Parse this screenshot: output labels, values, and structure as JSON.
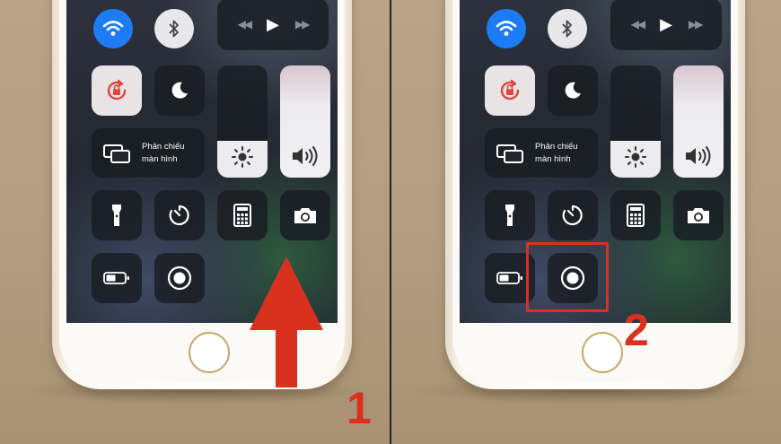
{
  "panels": [
    {
      "id": "left",
      "step_label": "1",
      "mirror_label_line1": "Phản chiếu",
      "mirror_label_line2": "màn hình"
    },
    {
      "id": "right",
      "step_label": "2",
      "mirror_label_line1": "Phản chiếu",
      "mirror_label_line2": "màn hình"
    }
  ],
  "control_center": {
    "brightness_level": 0.33,
    "volume_level": 1.0,
    "icons": [
      "wifi-icon",
      "bluetooth-icon",
      "rewind-icon",
      "play-icon",
      "fast-forward-icon",
      "rotation-lock-icon",
      "moon-icon",
      "screen-mirroring-icon",
      "brightness-icon",
      "volume-icon",
      "flashlight-icon",
      "timer-icon",
      "calculator-icon",
      "camera-icon",
      "battery-icon",
      "screen-record-icon"
    ]
  },
  "colors": {
    "accent_red": "#d8321f",
    "wifi_blue": "#1d7cf5",
    "background": "#b29d80"
  }
}
